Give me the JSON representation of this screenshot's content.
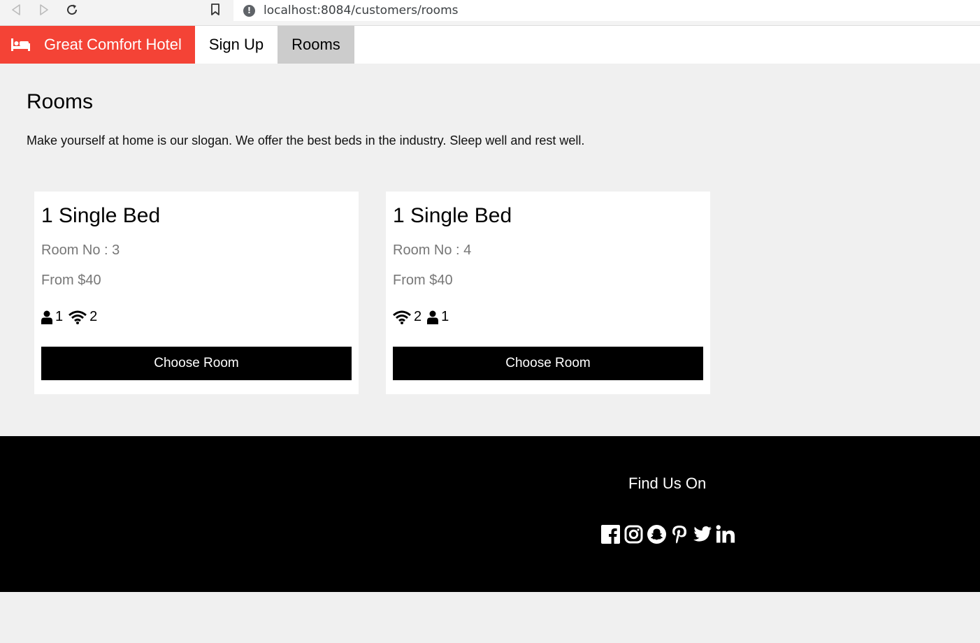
{
  "browser": {
    "url": "localhost:8084/customers/rooms",
    "info_symbol": "!"
  },
  "nav": {
    "brand": "Great Comfort Hotel",
    "links": [
      {
        "label": "Sign Up",
        "active": false
      },
      {
        "label": "Rooms",
        "active": true
      }
    ]
  },
  "page": {
    "title": "Rooms",
    "slogan": "Make yourself at home is our slogan. We offer the best beds in the industry. Sleep well and rest well."
  },
  "rooms": [
    {
      "title": "1 Single Bed",
      "room_no": "Room No : 3",
      "price": "From $40",
      "amenity_a": "1",
      "amenity_b": "2",
      "button": "Choose Room"
    },
    {
      "title": "1 Single Bed",
      "room_no": "Room No : 4",
      "price": "From $40",
      "amenity_a": "2",
      "amenity_b": "1",
      "button": "Choose Room"
    }
  ],
  "footer": {
    "heading": "Find Us On",
    "socials": [
      "facebook-icon",
      "instagram-icon",
      "snapchat-icon",
      "pinterest-icon",
      "twitter-icon",
      "linkedin-icon"
    ]
  },
  "colors": {
    "brand": "#f44336",
    "active_tab": "#cccccc",
    "page_bg": "#f0f0f0",
    "footer_bg": "#000000"
  }
}
